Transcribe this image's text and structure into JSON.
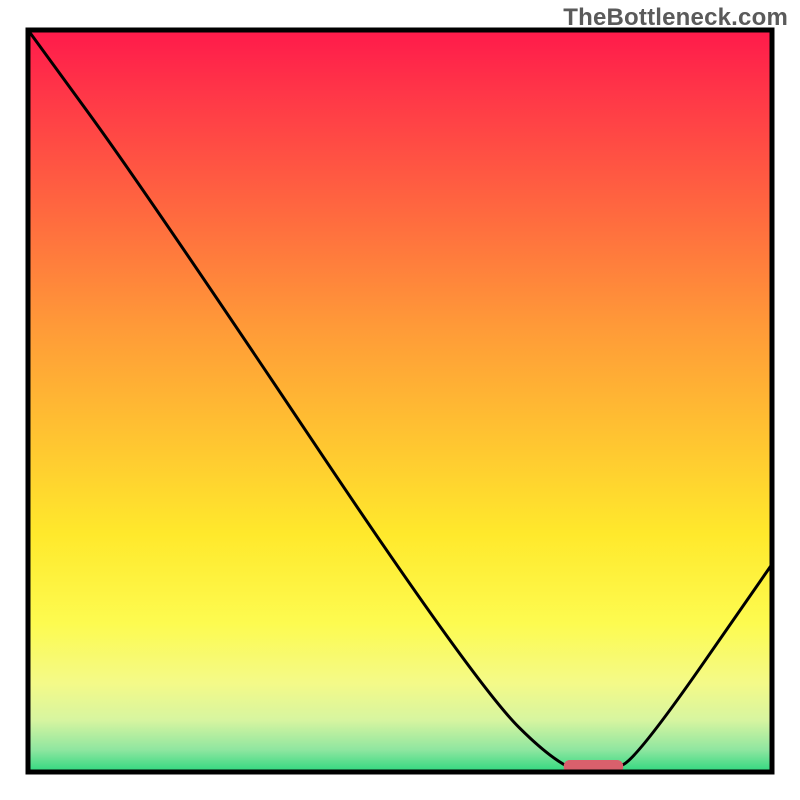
{
  "watermark": "TheBottleneck.com",
  "chart_data": {
    "type": "line",
    "title": "",
    "xlabel": "",
    "ylabel": "",
    "xlim": [
      0,
      100
    ],
    "ylim": [
      0,
      100
    ],
    "axes_visible": false,
    "grid": false,
    "series": [
      {
        "name": "bottleneck-curve",
        "x": [
          0,
          16,
          60,
          72,
          78,
          82,
          100
        ],
        "values": [
          100,
          78,
          12,
          0,
          0,
          2,
          28
        ]
      }
    ],
    "marker": {
      "name": "optimal-range",
      "x_start": 72,
      "x_end": 80,
      "y": 0,
      "color": "#d9606c"
    },
    "background_gradient": {
      "stops": [
        {
          "offset": 0.0,
          "color": "#ff1a4b"
        },
        {
          "offset": 0.1,
          "color": "#ff3b47"
        },
        {
          "offset": 0.25,
          "color": "#ff6a3f"
        },
        {
          "offset": 0.4,
          "color": "#ff9a38"
        },
        {
          "offset": 0.55,
          "color": "#ffc431"
        },
        {
          "offset": 0.68,
          "color": "#ffe92c"
        },
        {
          "offset": 0.8,
          "color": "#fdfb50"
        },
        {
          "offset": 0.88,
          "color": "#f4fa88"
        },
        {
          "offset": 0.93,
          "color": "#d7f5a0"
        },
        {
          "offset": 0.97,
          "color": "#8fe6a0"
        },
        {
          "offset": 1.0,
          "color": "#2fd87f"
        }
      ]
    },
    "frame_color": "#000000",
    "frame_width": 5
  }
}
